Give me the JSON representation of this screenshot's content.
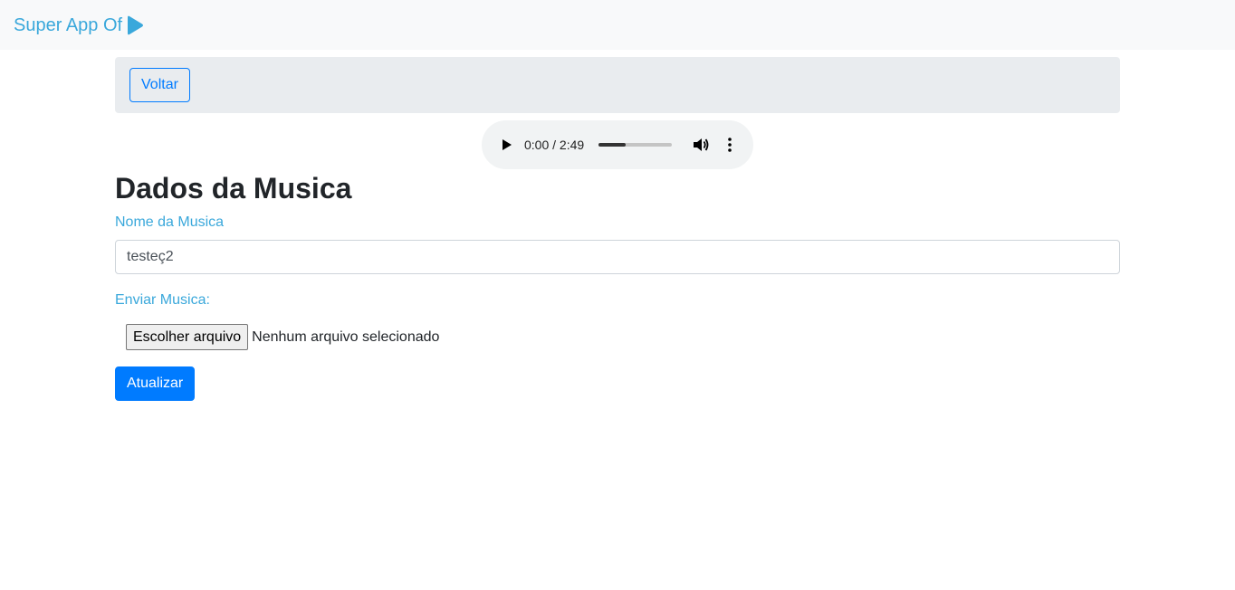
{
  "navbar": {
    "brand": "Super App Of",
    "brand_icon": "play-icon",
    "brand_color": "#3aa8db"
  },
  "toolbar": {
    "back_label": "Voltar"
  },
  "audio_player": {
    "time_display": "0:00 / 2:49",
    "progress_fraction": 0.37
  },
  "form": {
    "title": "Dados da Musica",
    "name_label": "Nome da Musica",
    "name_value": "testeç2",
    "file_label": "Enviar Musica:",
    "file_button": "Escolher arquivo",
    "file_status": "Nenhum arquivo selecionado",
    "submit_label": "Atualizar"
  },
  "colors": {
    "primary": "#007bff",
    "label": "#3aa8db",
    "topbar": "#e9ecef",
    "navbar": "#f8f9fa"
  }
}
